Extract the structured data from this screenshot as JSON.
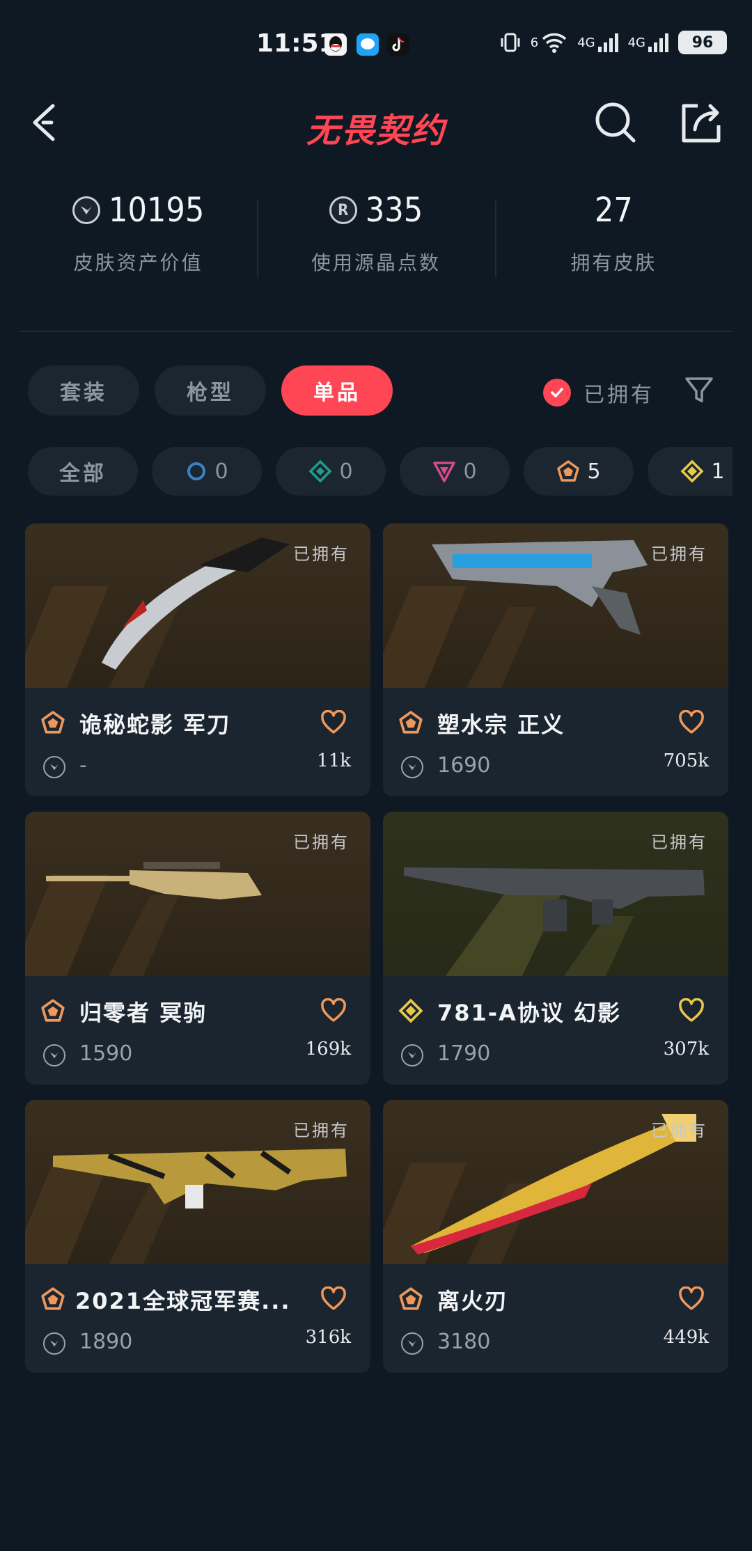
{
  "status_bar": {
    "time": "11:51",
    "network_1": "6",
    "network_2": "4G",
    "network_3": "4G",
    "battery": "96"
  },
  "header": {
    "logo_text": "无畏契约",
    "brand_color": "#ff4655"
  },
  "stats": [
    {
      "value": "10195",
      "label": "皮肤资产价值",
      "icon": "vp-coin-icon"
    },
    {
      "value": "335",
      "label": "使用源晶点数",
      "icon": "radianite-icon"
    },
    {
      "value": "27",
      "label": "拥有皮肤"
    }
  ],
  "segments": [
    {
      "label": "套装",
      "active": false
    },
    {
      "label": "枪型",
      "active": false
    },
    {
      "label": "单品",
      "active": true
    }
  ],
  "owned_filter": {
    "label": "已拥有",
    "checked": true
  },
  "tiers": [
    {
      "label": "全部"
    },
    {
      "count": "0",
      "color": "#3b82c4",
      "shape": "circle"
    },
    {
      "count": "0",
      "color": "#1f9c8a",
      "shape": "diamond"
    },
    {
      "count": "0",
      "color": "#d64a8c",
      "shape": "triangle"
    },
    {
      "count": "5",
      "color": "#f0975a",
      "shape": "pentagon"
    },
    {
      "count": "1",
      "color": "#e8c94a",
      "shape": "diamond"
    }
  ],
  "cards": [
    {
      "owned": "已拥有",
      "name": "诡秘蛇影 军刀",
      "price": "-",
      "likes": "11k",
      "tier_color": "#f0975a",
      "heart_color": "#f0975a"
    },
    {
      "owned": "已拥有",
      "name": "塑水宗 正义",
      "price": "1690",
      "likes": "705k",
      "tier_color": "#f0975a",
      "heart_color": "#f0975a"
    },
    {
      "owned": "已拥有",
      "name": "归零者 冥驹",
      "price": "1590",
      "likes": "169k",
      "tier_color": "#f0975a",
      "heart_color": "#f0975a"
    },
    {
      "owned": "已拥有",
      "name": "781-A协议 幻影",
      "price": "1790",
      "likes": "307k",
      "tier_color": "#e8c94a",
      "heart_color": "#e8c94a"
    },
    {
      "owned": "已拥有",
      "name": "2021全球冠军赛...",
      "price": "1890",
      "likes": "316k",
      "tier_color": "#f0975a",
      "heart_color": "#f0975a"
    },
    {
      "owned": "已拥有",
      "name": "离火刃",
      "price": "3180",
      "likes": "449k",
      "tier_color": "#f0975a",
      "heart_color": "#f0975a"
    }
  ]
}
